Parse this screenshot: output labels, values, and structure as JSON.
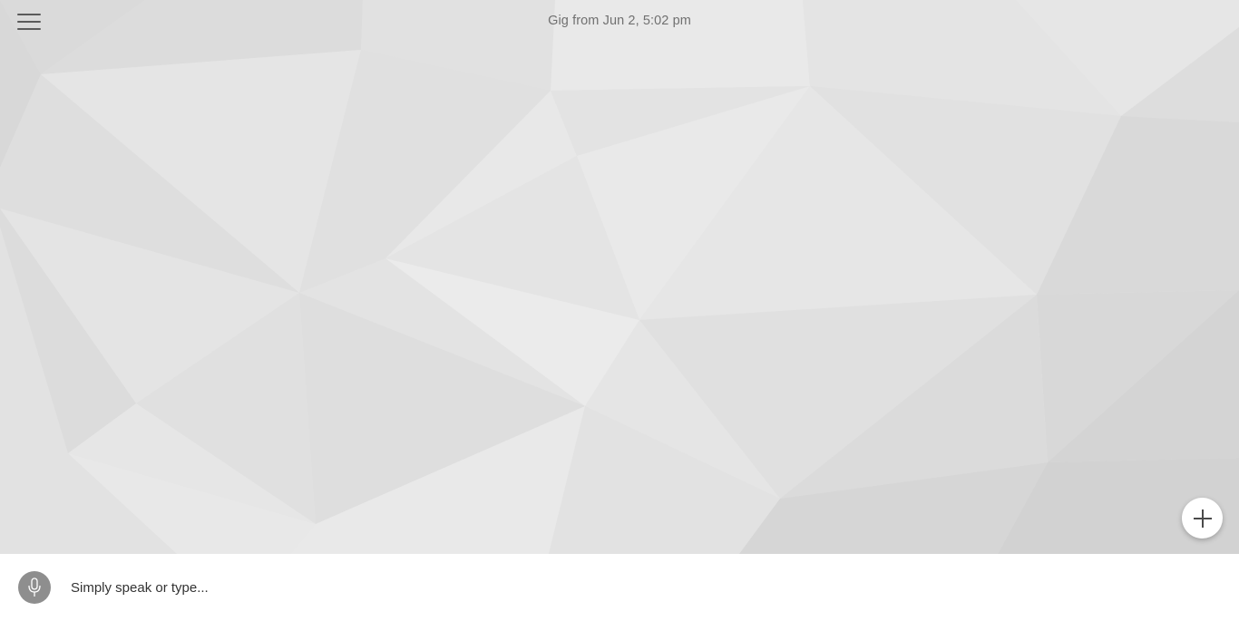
{
  "header": {
    "title": "Gig from Jun 2, 5:02 pm",
    "menu_icon": "hamburger-menu-icon"
  },
  "fab": {
    "icon": "plus-icon"
  },
  "input_bar": {
    "placeholder": "Simply speak or type...",
    "value": "",
    "mic_icon": "microphone-icon"
  },
  "colors": {
    "background_base": "#e3e3e3",
    "title_text": "#707070",
    "mic_button_bg": "#8e8e8e",
    "fab_bg": "#ffffff",
    "input_bar_bg": "#ffffff"
  }
}
